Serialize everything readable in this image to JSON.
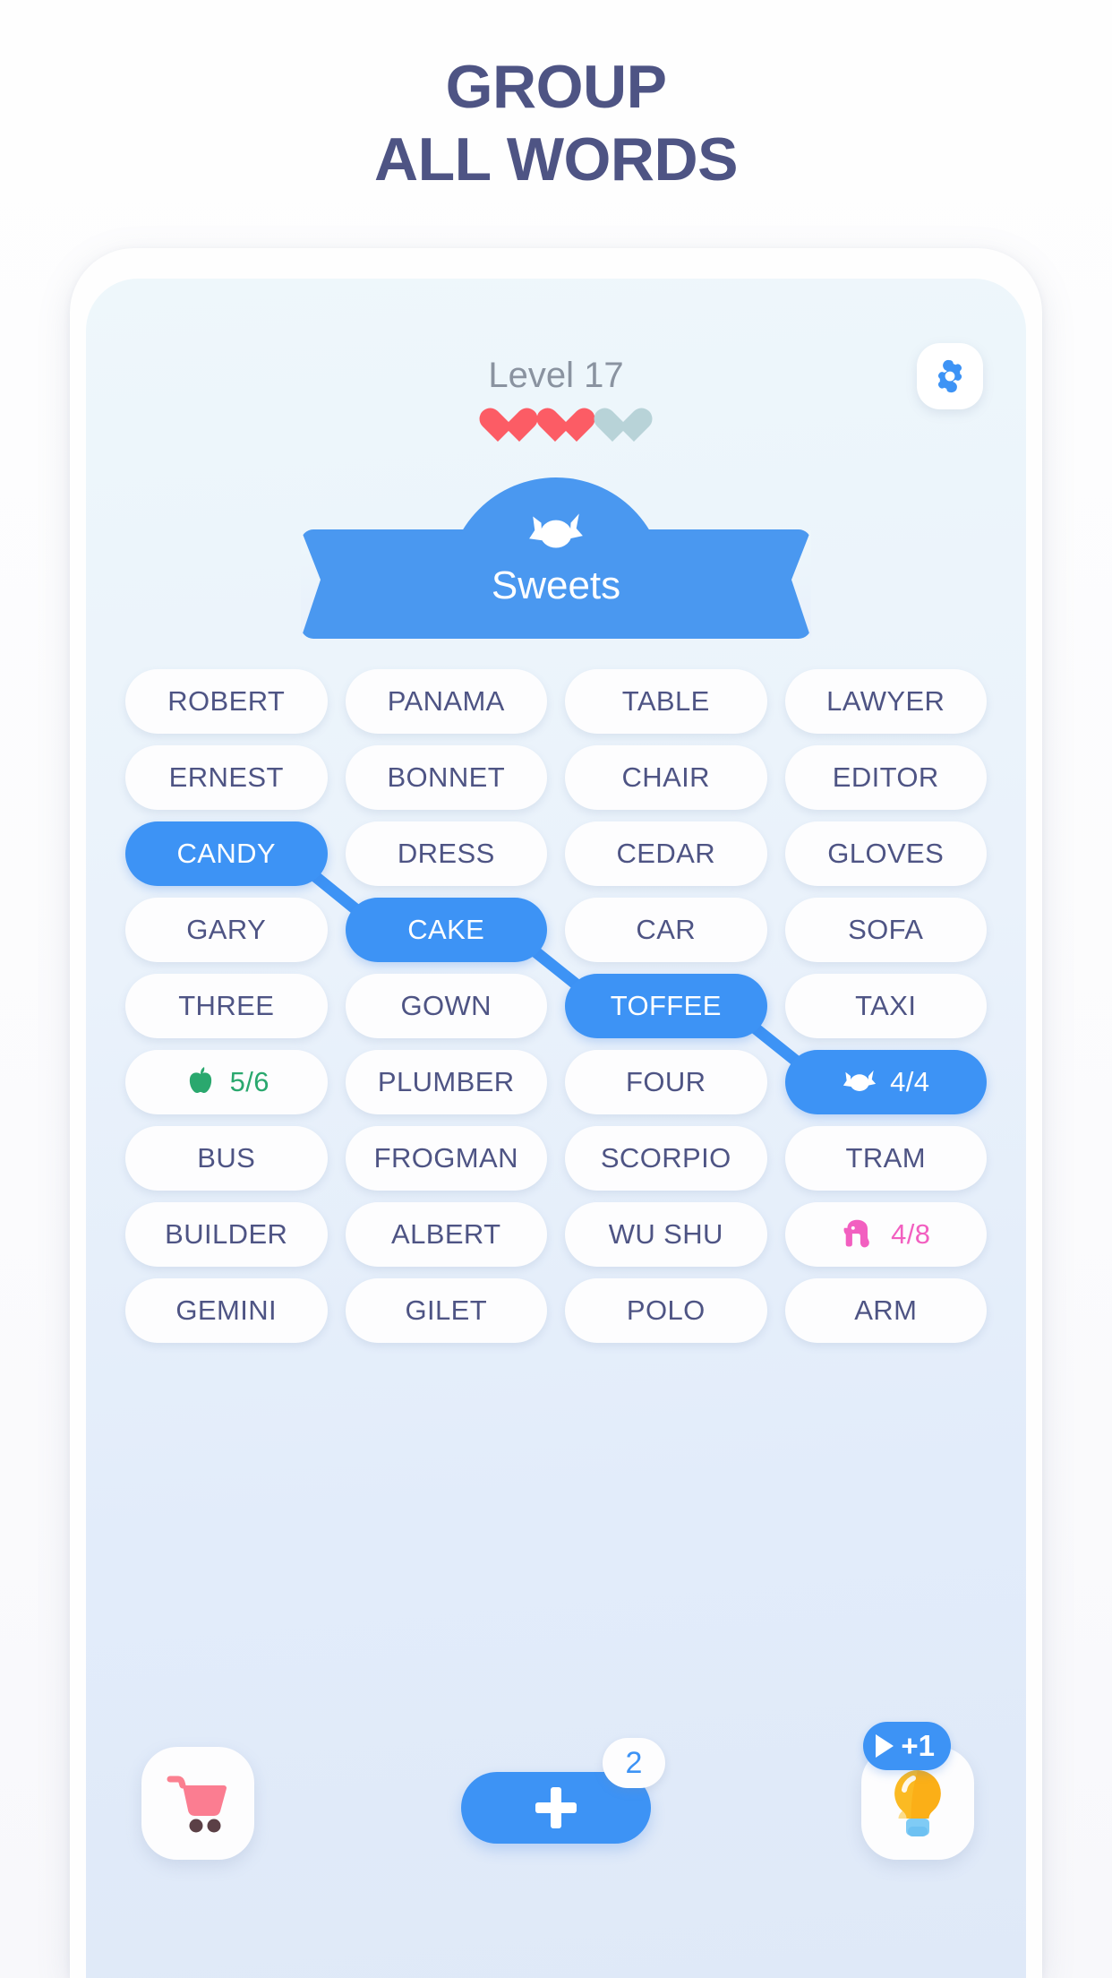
{
  "headline": {
    "line1": "GROUP",
    "line2": "ALL WORDS",
    "color": "#4e5484"
  },
  "header": {
    "level_label": "Level 17",
    "hearts": [
      {
        "name": "heart-full-1",
        "state": "full"
      },
      {
        "name": "heart-full-2",
        "state": "full"
      },
      {
        "name": "heart-empty-3",
        "state": "empty"
      }
    ],
    "settings_icon": "gear-icon"
  },
  "banner": {
    "title": "Sweets",
    "icon": "candy-icon",
    "color": "#4a98f0"
  },
  "grid": {
    "columns": 4,
    "tiles": [
      {
        "label": "ROBERT",
        "type": "word",
        "state": "normal"
      },
      {
        "label": "PANAMA",
        "type": "word",
        "state": "normal"
      },
      {
        "label": "TABLE",
        "type": "word",
        "state": "normal"
      },
      {
        "label": "LAWYER",
        "type": "word",
        "state": "normal"
      },
      {
        "label": "ERNEST",
        "type": "word",
        "state": "normal"
      },
      {
        "label": "BONNET",
        "type": "word",
        "state": "normal"
      },
      {
        "label": "CHAIR",
        "type": "word",
        "state": "normal"
      },
      {
        "label": "EDITOR",
        "type": "word",
        "state": "normal"
      },
      {
        "label": "CANDY",
        "type": "word",
        "state": "selected"
      },
      {
        "label": "DRESS",
        "type": "word",
        "state": "normal"
      },
      {
        "label": "CEDAR",
        "type": "word",
        "state": "normal"
      },
      {
        "label": "GLOVES",
        "type": "word",
        "state": "normal"
      },
      {
        "label": "GARY",
        "type": "word",
        "state": "normal"
      },
      {
        "label": "CAKE",
        "type": "word",
        "state": "selected"
      },
      {
        "label": "CAR",
        "type": "word",
        "state": "normal"
      },
      {
        "label": "SOFA",
        "type": "word",
        "state": "normal"
      },
      {
        "label": "THREE",
        "type": "word",
        "state": "normal"
      },
      {
        "label": "GOWN",
        "type": "word",
        "state": "normal"
      },
      {
        "label": "TOFFEE",
        "type": "word",
        "state": "selected"
      },
      {
        "label": "TAXI",
        "type": "word",
        "state": "normal"
      },
      {
        "label": "5/6",
        "type": "counter",
        "icon": "apple-icon",
        "state": "green"
      },
      {
        "label": "PLUMBER",
        "type": "word",
        "state": "normal"
      },
      {
        "label": "FOUR",
        "type": "word",
        "state": "normal"
      },
      {
        "label": "4/4",
        "type": "counter",
        "icon": "candy-icon",
        "state": "bluefill"
      },
      {
        "label": "BUS",
        "type": "word",
        "state": "normal"
      },
      {
        "label": "FROGMAN",
        "type": "word",
        "state": "normal"
      },
      {
        "label": "SCORPIO",
        "type": "word",
        "state": "normal"
      },
      {
        "label": "TRAM",
        "type": "word",
        "state": "normal"
      },
      {
        "label": "BUILDER",
        "type": "word",
        "state": "normal"
      },
      {
        "label": "ALBERT",
        "type": "word",
        "state": "normal"
      },
      {
        "label": "WU SHU",
        "type": "word",
        "state": "normal"
      },
      {
        "label": "4/8",
        "type": "counter",
        "icon": "elephant-icon",
        "state": "pink"
      },
      {
        "label": "GEMINI",
        "type": "word",
        "state": "normal"
      },
      {
        "label": "GILET",
        "type": "word",
        "state": "normal"
      },
      {
        "label": "POLO",
        "type": "word",
        "state": "normal"
      },
      {
        "label": "ARM",
        "type": "word",
        "state": "normal"
      }
    ],
    "connections": [
      {
        "from": 8,
        "to": 13
      },
      {
        "from": 13,
        "to": 18
      },
      {
        "from": 18,
        "to": 23
      }
    ]
  },
  "toolbar": {
    "cart_icon": "shopping-cart-icon",
    "add_label": "+",
    "add_badge_count": "2",
    "hint_icon": "lightbulb-icon",
    "hint_badge_label": "+1",
    "hint_badge_icon": "play-icon"
  },
  "colors": {
    "accent_blue": "#3d93f5",
    "banner_blue": "#4a98f0",
    "text_slate": "#4e5484",
    "heart_red": "#fc5c65",
    "heart_empty": "#b8d3d8",
    "counter_green": "#2aa86e",
    "counter_pink": "#f25fc0",
    "cart_pink": "#fb7185",
    "bulb_orange": "#fbaf17"
  }
}
